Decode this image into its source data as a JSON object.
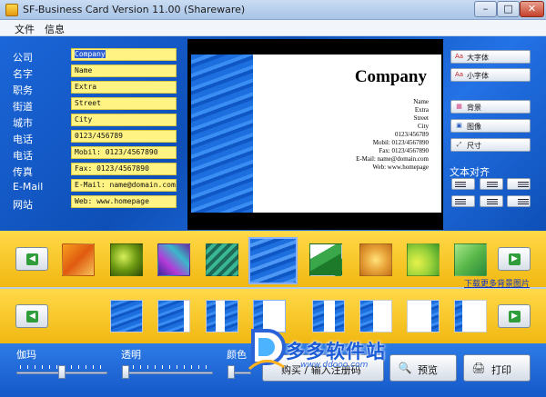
{
  "window": {
    "title": "SF-Business Card  Version 11.00 (Shareware)",
    "minimize": "–",
    "maximize": "□",
    "close": "✕"
  },
  "menu": {
    "file": "文件",
    "info": "信息"
  },
  "fields": [
    {
      "label": "公司",
      "value": "Company"
    },
    {
      "label": "名字",
      "value": "Name"
    },
    {
      "label": "职务",
      "value": "Extra"
    },
    {
      "label": "街道",
      "value": "Street"
    },
    {
      "label": "城市",
      "value": "City"
    },
    {
      "label": "电话",
      "value": "0123/456789"
    },
    {
      "label": "电话",
      "value": "Mobil: 0123/4567890"
    },
    {
      "label": "传真",
      "value": "Fax: 0123/4567890"
    },
    {
      "label": "E-Mail",
      "value": "E-Mail: name@domain.com"
    },
    {
      "label": "网站",
      "value": "Web: www.homepage"
    }
  ],
  "card": {
    "company": "Company",
    "lines": [
      "Name",
      "Extra",
      "Street",
      "City",
      "0123/456789",
      "Mobil: 0123/4567890",
      "Fax: 0123/4567890",
      "E-Mail: name@domain.com",
      "Web: www.homepage"
    ]
  },
  "side": {
    "large_font": "大字体",
    "small_font": "小字体",
    "background": "背景",
    "image": "图像",
    "size": "尺寸",
    "text_align": "文本对齐",
    "large_font_icon": "Aa",
    "small_font_icon": "Aa",
    "background_icon": "▦",
    "image_icon": "▣",
    "size_icon": "⤢"
  },
  "backgrounds": {
    "download_link": "下载更多背景图片",
    "prev_icon": "◀",
    "next_icon": "▶",
    "colors": [
      "#e88b1a",
      "#8fba1e",
      "#8a3ab8",
      "#2a8a70",
      "#1e6fe0",
      "#3aa84a",
      "#e8a43a",
      "#b7d23a",
      "#5ab84a"
    ]
  },
  "layouts": {
    "prev_icon": "◀",
    "next_icon": "▶"
  },
  "bottom": {
    "fade_label": "伽玛",
    "transparency_label": "透明",
    "color_label": "颜色",
    "buy_label": "购买 / 输入注册码",
    "preview_label": "预览",
    "print_label": "打印",
    "fade_value": 0.5,
    "transparency_value": 0.0,
    "color_value": 0.0,
    "preview_icon": "🔍",
    "print_icon": "🖨"
  },
  "watermark": {
    "text": "多多软件站",
    "url": "www.ddooo.com"
  }
}
